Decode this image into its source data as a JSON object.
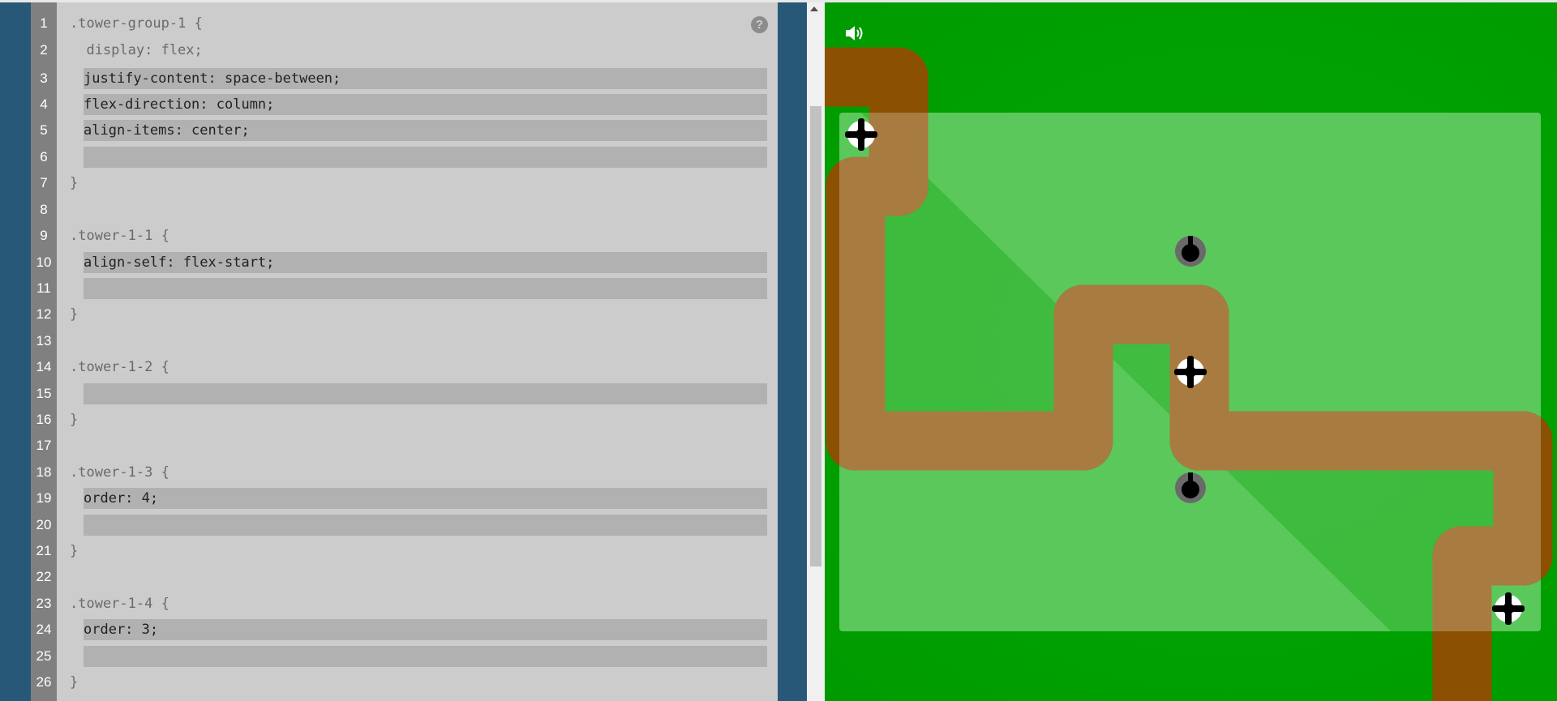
{
  "editor": {
    "help_icon": "help-icon",
    "help_label": "?",
    "lines": [
      {
        "n": "1",
        "text": ".tower-group-1 {",
        "editable": false
      },
      {
        "n": "2",
        "text": "  display: flex;",
        "editable": false
      },
      {
        "n": "3",
        "text": "justify-content: space-between;",
        "editable": true
      },
      {
        "n": "4",
        "text": "flex-direction: column;",
        "editable": true
      },
      {
        "n": "5",
        "text": "align-items: center;",
        "editable": true
      },
      {
        "n": "6",
        "text": "",
        "editable": true
      },
      {
        "n": "7",
        "text": "}",
        "editable": false
      },
      {
        "n": "8",
        "text": "",
        "editable": false
      },
      {
        "n": "9",
        "text": ".tower-1-1 {",
        "editable": false
      },
      {
        "n": "10",
        "text": "align-self: flex-start;",
        "editable": true
      },
      {
        "n": "11",
        "text": "",
        "editable": true
      },
      {
        "n": "12",
        "text": "}",
        "editable": false
      },
      {
        "n": "13",
        "text": "",
        "editable": false
      },
      {
        "n": "14",
        "text": ".tower-1-2 {",
        "editable": false
      },
      {
        "n": "15",
        "text": "",
        "editable": true
      },
      {
        "n": "16",
        "text": "}",
        "editable": false
      },
      {
        "n": "17",
        "text": "",
        "editable": false
      },
      {
        "n": "18",
        "text": ".tower-1-3 {",
        "editable": false
      },
      {
        "n": "19",
        "text": "order: 4;",
        "editable": true
      },
      {
        "n": "20",
        "text": "",
        "editable": true
      },
      {
        "n": "21",
        "text": "}",
        "editable": false
      },
      {
        "n": "22",
        "text": "",
        "editable": false
      },
      {
        "n": "23",
        "text": ".tower-1-4 {",
        "editable": false
      },
      {
        "n": "24",
        "text": "order: 3;",
        "editable": true
      },
      {
        "n": "25",
        "text": "",
        "editable": true
      },
      {
        "n": "26",
        "text": "}",
        "editable": false
      }
    ]
  },
  "game": {
    "sound_icon": "speaker-icon",
    "towers": [
      {
        "kind": "gun",
        "icon": "gun-tower-icon"
      },
      {
        "kind": "gun",
        "icon": "gun-tower-icon"
      },
      {
        "kind": "target",
        "icon": "crosshair-target-icon"
      },
      {
        "kind": "target",
        "icon": "crosshair-target-icon"
      },
      {
        "kind": "target",
        "icon": "crosshair-target-icon"
      }
    ]
  },
  "colors": {
    "sidebar": "#285877",
    "editor_bg": "#cccccc",
    "gutter": "#808080",
    "input_highlight": "#b1b1b1",
    "grass": "#00a100",
    "grass_highlight": "#45bc45",
    "path": "#8b5001",
    "path_on_highlight": "#a87c40"
  }
}
